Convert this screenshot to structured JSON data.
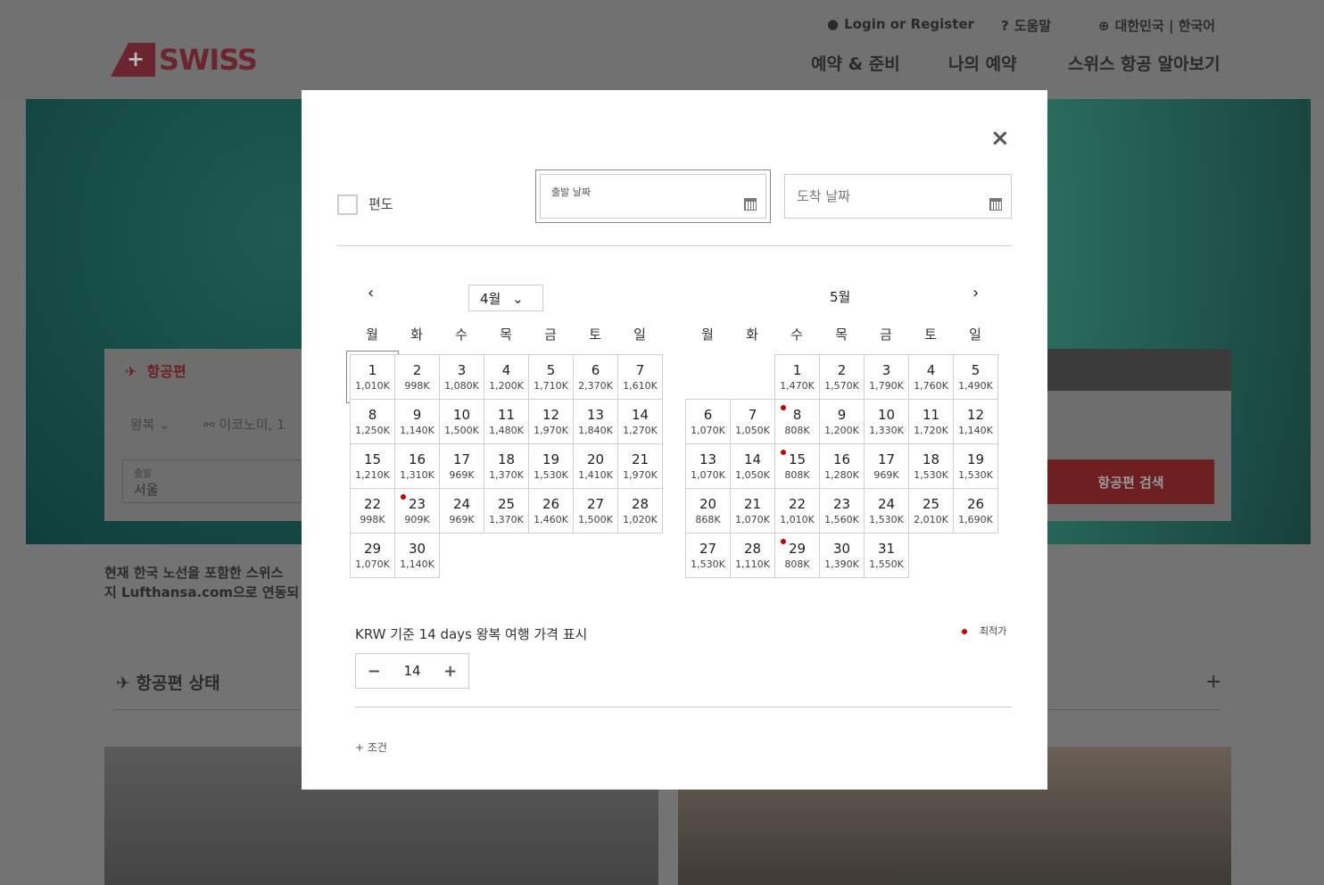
{
  "header": {
    "logo": "SWISS",
    "login": "Login or Register",
    "help": "도움말",
    "locale": "대한민국 | 한국어",
    "nav": [
      "예약 & 준비",
      "나의 예약",
      "스위스 항공 알아보기"
    ]
  },
  "booking": {
    "tab": "항공편",
    "trip_type": "왕복",
    "cabin": "이코노미, 1",
    "from_label": "출발",
    "from_value": "서울",
    "search": "항공편 검색"
  },
  "notice": {
    "line1": "현재 한국 노선을 포함한 스위스",
    "line2": "지 Lufthansa.com으로 연동되"
  },
  "status": {
    "title": "항공편 상태",
    "expand": "+"
  },
  "modal": {
    "close": "×",
    "oneway_label": "편도",
    "depart_label": "출발 날짜",
    "return_placeholder": "도착 날짜",
    "prev": "‹",
    "next": "›",
    "weekdays": [
      "월",
      "화",
      "수",
      "목",
      "금",
      "토",
      "일"
    ],
    "months": [
      {
        "label": "4월",
        "offset": 0,
        "days": [
          [
            "1",
            "1,010K"
          ],
          [
            "2",
            "998K"
          ],
          [
            "3",
            "1,080K"
          ],
          [
            "4",
            "1,200K"
          ],
          [
            "5",
            "1,710K"
          ],
          [
            "6",
            "2,370K"
          ],
          [
            "7",
            "1,610K"
          ],
          [
            "8",
            "1,250K"
          ],
          [
            "9",
            "1,140K"
          ],
          [
            "10",
            "1,500K"
          ],
          [
            "11",
            "1,480K"
          ],
          [
            "12",
            "1,970K"
          ],
          [
            "13",
            "1,840K"
          ],
          [
            "14",
            "1,270K"
          ],
          [
            "15",
            "1,210K"
          ],
          [
            "16",
            "1,310K"
          ],
          [
            "17",
            "969K"
          ],
          [
            "18",
            "1,370K"
          ],
          [
            "19",
            "1,530K"
          ],
          [
            "20",
            "1,410K"
          ],
          [
            "21",
            "1,970K"
          ],
          [
            "22",
            "998K"
          ],
          [
            "23",
            "909K"
          ],
          [
            "24",
            "969K"
          ],
          [
            "25",
            "1,370K"
          ],
          [
            "26",
            "1,460K"
          ],
          [
            "27",
            "1,500K"
          ],
          [
            "28",
            "1,020K"
          ],
          [
            "29",
            "1,070K"
          ],
          [
            "30",
            "1,140K"
          ]
        ],
        "lowest": [
          "23"
        ],
        "focused": "1"
      },
      {
        "label": "5월",
        "offset": 2,
        "days": [
          [
            "1",
            "1,470K"
          ],
          [
            "2",
            "1,570K"
          ],
          [
            "3",
            "1,790K"
          ],
          [
            "4",
            "1,760K"
          ],
          [
            "5",
            "1,490K"
          ],
          [
            "6",
            "1,070K"
          ],
          [
            "7",
            "1,050K"
          ],
          [
            "8",
            "808K"
          ],
          [
            "9",
            "1,200K"
          ],
          [
            "10",
            "1,330K"
          ],
          [
            "11",
            "1,720K"
          ],
          [
            "12",
            "1,140K"
          ],
          [
            "13",
            "1,070K"
          ],
          [
            "14",
            "1,050K"
          ],
          [
            "15",
            "808K"
          ],
          [
            "16",
            "1,280K"
          ],
          [
            "17",
            "969K"
          ],
          [
            "18",
            "1,530K"
          ],
          [
            "19",
            "1,530K"
          ],
          [
            "20",
            "868K"
          ],
          [
            "21",
            "1,070K"
          ],
          [
            "22",
            "1,010K"
          ],
          [
            "23",
            "1,560K"
          ],
          [
            "24",
            "1,530K"
          ],
          [
            "25",
            "2,010K"
          ],
          [
            "26",
            "1,690K"
          ],
          [
            "27",
            "1,530K"
          ],
          [
            "28",
            "1,110K"
          ],
          [
            "29",
            "808K"
          ],
          [
            "30",
            "1,390K"
          ],
          [
            "31",
            "1,550K"
          ]
        ],
        "lowest": [
          "8",
          "15",
          "29"
        ]
      }
    ],
    "price_note": "KRW 기준 14 days 왕복 여행 가격 표시",
    "legend": "최적가",
    "stepper": {
      "minus": "−",
      "value": "14",
      "plus": "+"
    },
    "conditions": "+ 조건",
    "accent": "#cc0000"
  }
}
